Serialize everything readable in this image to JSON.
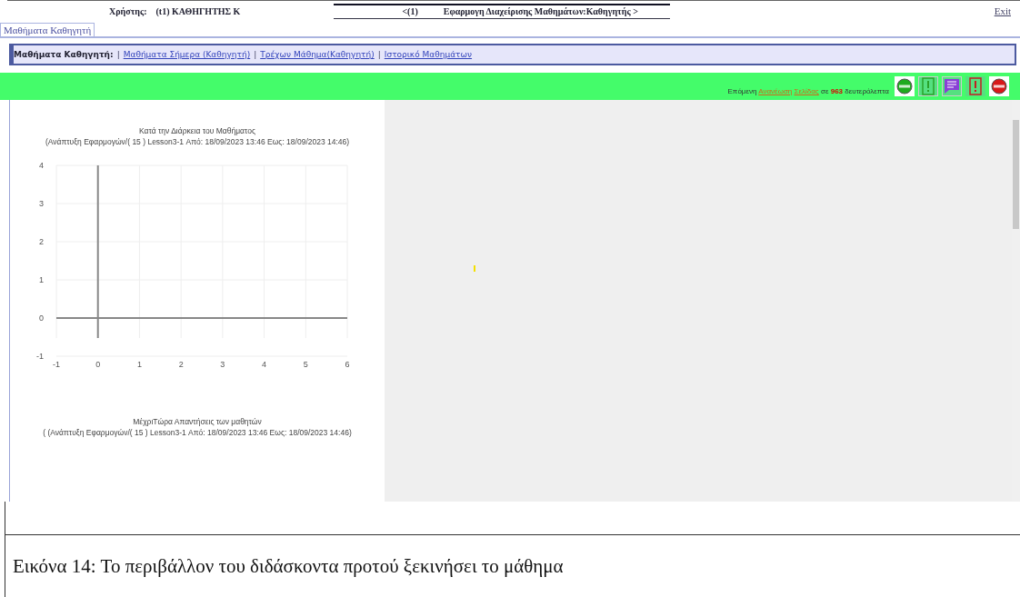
{
  "header": {
    "user_label": "Χρήστης:",
    "user_name": "(t1) ΚΑΘΗΓΗΤΗΣ Κ",
    "app_index": "<(1)",
    "app_title": "Εφαρμογη Διαχείρισης Μαθημάτων:Καθηγητής >",
    "exit_link": "Exit"
  },
  "tabs": [
    {
      "label": "Μαθήματα Καθηγητή",
      "selected": true
    }
  ],
  "nav": {
    "title": "Μαθήματα Καθηγητή:",
    "separator": "|",
    "links": [
      "Μαθήματα Σήμερα (Καθηγητή) ",
      "Τρέχων Μάθημα(Καθηγητή) ",
      "Ιστορικό Μαθημάτων"
    ]
  },
  "refresh_bar": {
    "prefix": "Επόμενη",
    "link_1": "Ανανέωση",
    "link_2": "Σελίδας",
    "middle": "σε",
    "seconds": "963",
    "suffix": "δευτερόλεπτα",
    "buttons": [
      {
        "kind": "start"
      },
      {
        "kind": "alert"
      },
      {
        "kind": "message"
      },
      {
        "kind": "alert-red"
      },
      {
        "kind": "stop"
      }
    ]
  },
  "chart_panel": {
    "subtitle": "(Ανάπτυξη Εφαρμογών/( 15 ) Lesson3-1 Από: 18/09/2023 13:46 Εως: 18/09/2023 14:46)",
    "chart_data": {
      "type": "line",
      "grid": true,
      "title": "Κατά την Διάρκεια του Μαθήματος",
      "xlim": [
        -1,
        6
      ],
      "ylim": [
        -1,
        4
      ],
      "xticks": [
        -1,
        0,
        1,
        2,
        3,
        4,
        5,
        6
      ],
      "yticks": [
        -1,
        0,
        1,
        2,
        3,
        4
      ]
    },
    "second_title": "ΜέχριΤώρα Απαντήσεις των μαθητών",
    "second_subtitle": "( (Ανάπτυξη Εφαρμογών/( 15 ) Lesson3-1 Από: 18/09/2023 13:46 Εως: 18/09/2023 14:46)"
  },
  "caption": "Εικόνα 14: Το περιβάλλον του διδάσκοντα προτού ξεκινήσει το μάθημα"
}
